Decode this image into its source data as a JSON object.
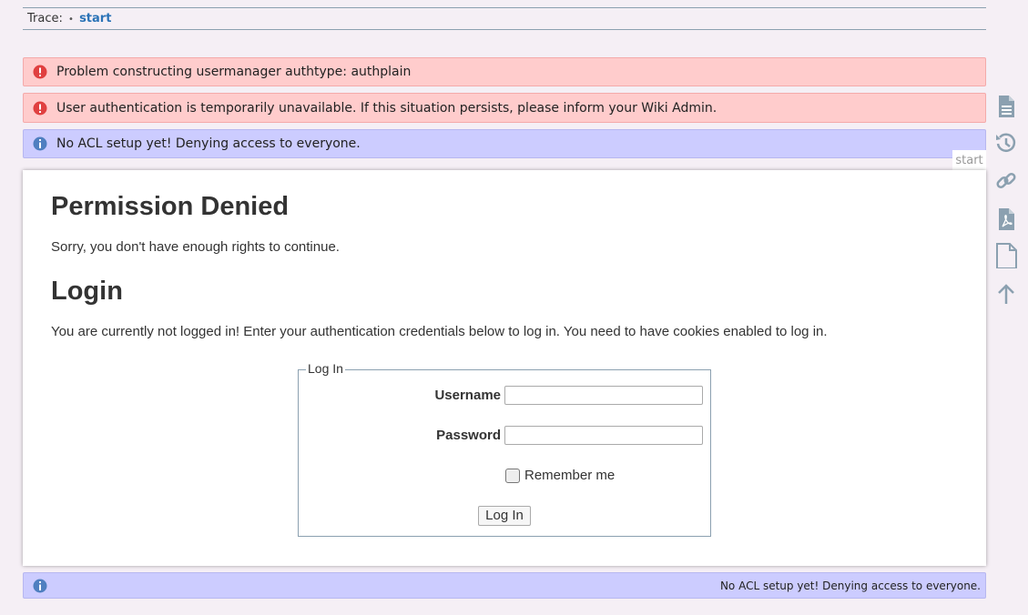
{
  "trace": {
    "label": "Trace:",
    "bullet": "•",
    "link": "start"
  },
  "messages": {
    "error1": "Problem constructing usermanager authtype: authplain",
    "error2": "User authentication is temporarily unavailable. If this situation persists, please inform your Wiki Admin.",
    "info1": "No ACL setup yet! Denying access to everyone.",
    "info2": "No ACL setup yet! Denying access to everyone."
  },
  "page_tab": "start",
  "content": {
    "heading1": "Permission Denied",
    "text1": "Sorry, you don't have enough rights to continue.",
    "heading2": "Login",
    "text2": "You are currently not logged in! Enter your authentication credentials below to log in. You need to have cookies enabled to log in."
  },
  "login": {
    "legend": "Log In",
    "username_label": "Username",
    "username_value": "",
    "password_label": "Password",
    "password_value": "",
    "remember_label": "Remember me",
    "remember_checked": false,
    "submit_label": "Log In"
  },
  "colors": {
    "error_bg": "#ffcccc",
    "info_bg": "#ccccff",
    "link": "#2b73b7",
    "tool_icon": "#8ba0b0"
  },
  "toolbar": {
    "icons": [
      "show-page-icon",
      "old-revisions-icon",
      "backlinks-icon",
      "export-pdf-icon",
      "odt-export-icon",
      "back-to-top-icon"
    ]
  }
}
